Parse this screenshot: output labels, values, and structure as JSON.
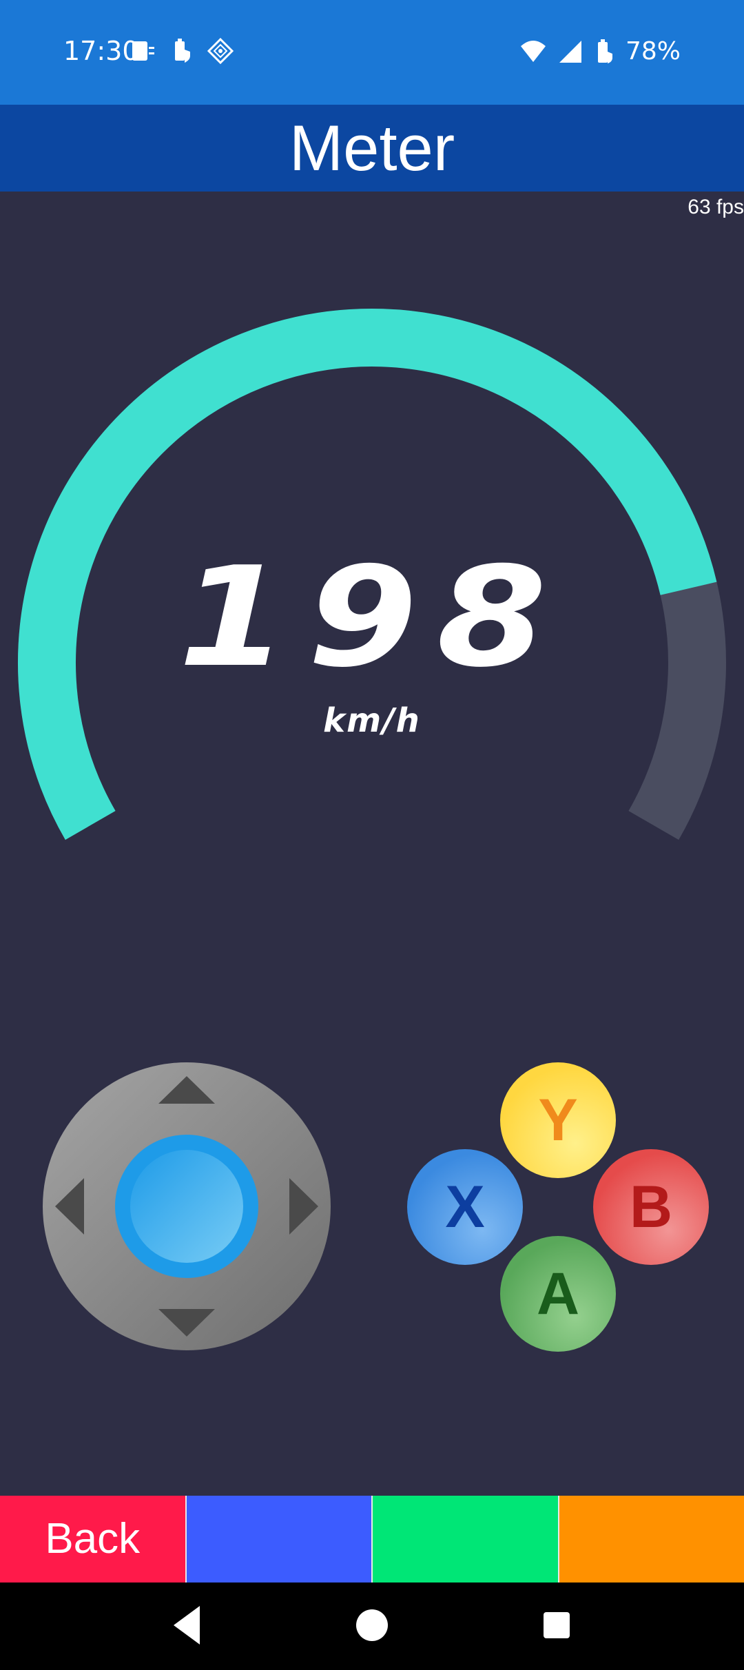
{
  "status_bar": {
    "time": "17:30",
    "battery": "78%",
    "left_icons": [
      "sim-card-icon",
      "battery-saver-icon",
      "vpn-diamond-icon"
    ],
    "right_icons": [
      "wifi-icon",
      "signal-icon",
      "battery-icon"
    ]
  },
  "header": {
    "title": "Meter"
  },
  "fps": "63 fps",
  "gauge": {
    "value": "198",
    "unit": "km/h",
    "fill_fraction": 0.82,
    "fill_color": "#40e0d0",
    "track_color": "#4a4d60"
  },
  "dpad": {
    "icons": [
      "arrow-up-icon",
      "arrow-down-icon",
      "arrow-left-icon",
      "arrow-right-icon"
    ],
    "knob_color": "#1e9be8"
  },
  "face_buttons": {
    "y": "Y",
    "x": "X",
    "b": "B",
    "a": "A"
  },
  "bottom_bar": {
    "back_label": "Back",
    "colors": [
      "#ff1a4a",
      "#3c5cff",
      "#00e676",
      "#ff9100"
    ]
  },
  "nav_bar": {
    "icons": [
      "back-triangle-icon",
      "home-circle-icon",
      "recents-square-icon"
    ]
  }
}
